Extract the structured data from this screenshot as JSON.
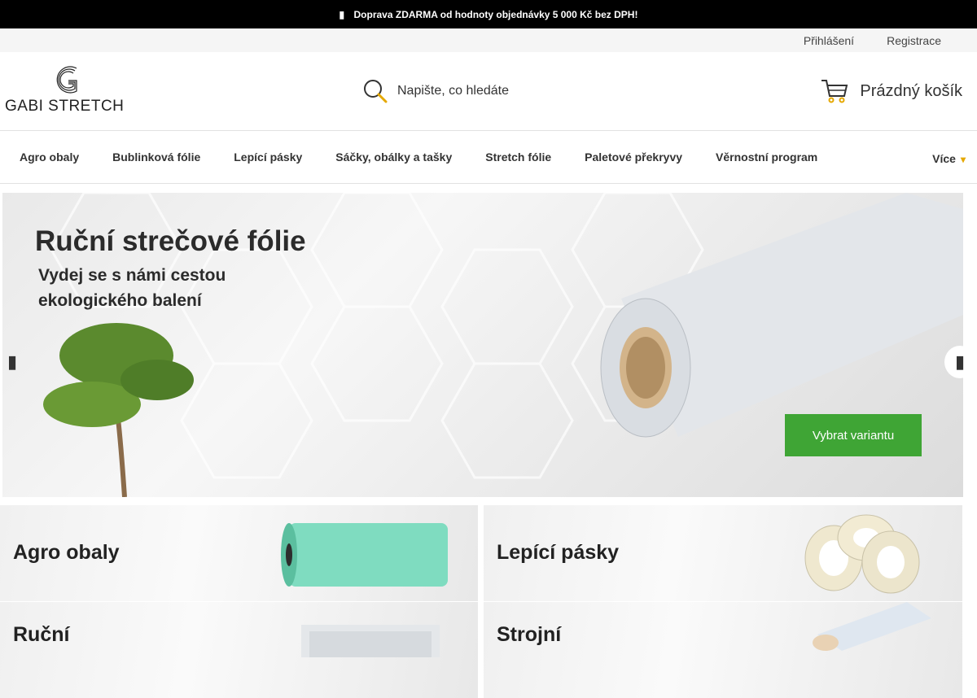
{
  "topbar": {
    "text": "Doprava ZDARMA od hodnoty objednávky 5 000 Kč bez DPH!",
    "icon": "info-icon"
  },
  "userbar": {
    "login": "Přihlášení",
    "register": "Registrace"
  },
  "header": {
    "logo_text": "GABI STRETCH",
    "search_placeholder": "Napište, co hledáte",
    "cart_label": "Prázdný košík"
  },
  "nav": {
    "items": [
      "Agro obaly",
      "Bublinková fólie",
      "Lepící pásky",
      "Sáčky, obálky a tašky",
      "Stretch fólie",
      "Paletové překryvy",
      "Věrnostní program"
    ],
    "more": "Více"
  },
  "hero": {
    "title": "Ruční strečové fólie",
    "subtitle": "Vydej se s námi cestou ekologického balení",
    "cta": "Vybrat variantu"
  },
  "categories": [
    {
      "label": "Agro obaly"
    },
    {
      "label": "Lepící pásky"
    },
    {
      "label": "Ruční"
    },
    {
      "label": "Strojní"
    }
  ],
  "colors": {
    "accent": "#3fa535",
    "topbar": "#000000",
    "more_icon": "#e5a800"
  }
}
